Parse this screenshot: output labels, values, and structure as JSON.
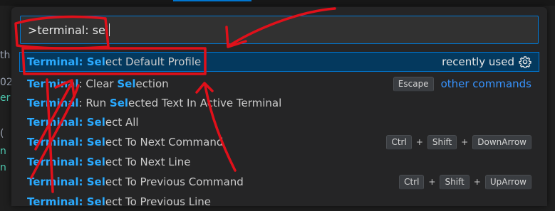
{
  "background": {
    "fragments": [
      "th",
      "02",
      "er",
      "(",
      "n",
      "n"
    ]
  },
  "palette": {
    "input_value": ">terminal: sel",
    "items": [
      {
        "hl": "Terminal: Sel",
        "rest": "ect Default Profile",
        "right_label": "recently used",
        "right_icon": "gear-icon"
      },
      {
        "hl1": "Terminal",
        "mid": ": Clear ",
        "hl2": "Sel",
        "rest": "ection",
        "key": "Escape",
        "link": "other commands"
      },
      {
        "hl1": "Terminal",
        "mid": ": Run ",
        "hl2": "Sel",
        "rest": "ected Text In Active Terminal"
      },
      {
        "hl": "Terminal: Sel",
        "rest": "ect All"
      },
      {
        "hl": "Terminal: Sel",
        "rest": "ect To Next Command",
        "keys": [
          "Ctrl",
          "Shift",
          "DownArrow"
        ]
      },
      {
        "hl": "Terminal: Sel",
        "rest": "ect To Next Line"
      },
      {
        "hl": "Terminal: Sel",
        "rest": "ect To Previous Command",
        "keys": [
          "Ctrl",
          "Shift",
          "UpArrow"
        ]
      },
      {
        "hl": "Terminal: Sel",
        "rest": "ect To Previous Line"
      }
    ],
    "plus": "+"
  },
  "colors": {
    "accent": "#0078d4",
    "highlight": "#2aaaff",
    "selected_bg": "#04395e",
    "annotation": "#e0101a"
  }
}
